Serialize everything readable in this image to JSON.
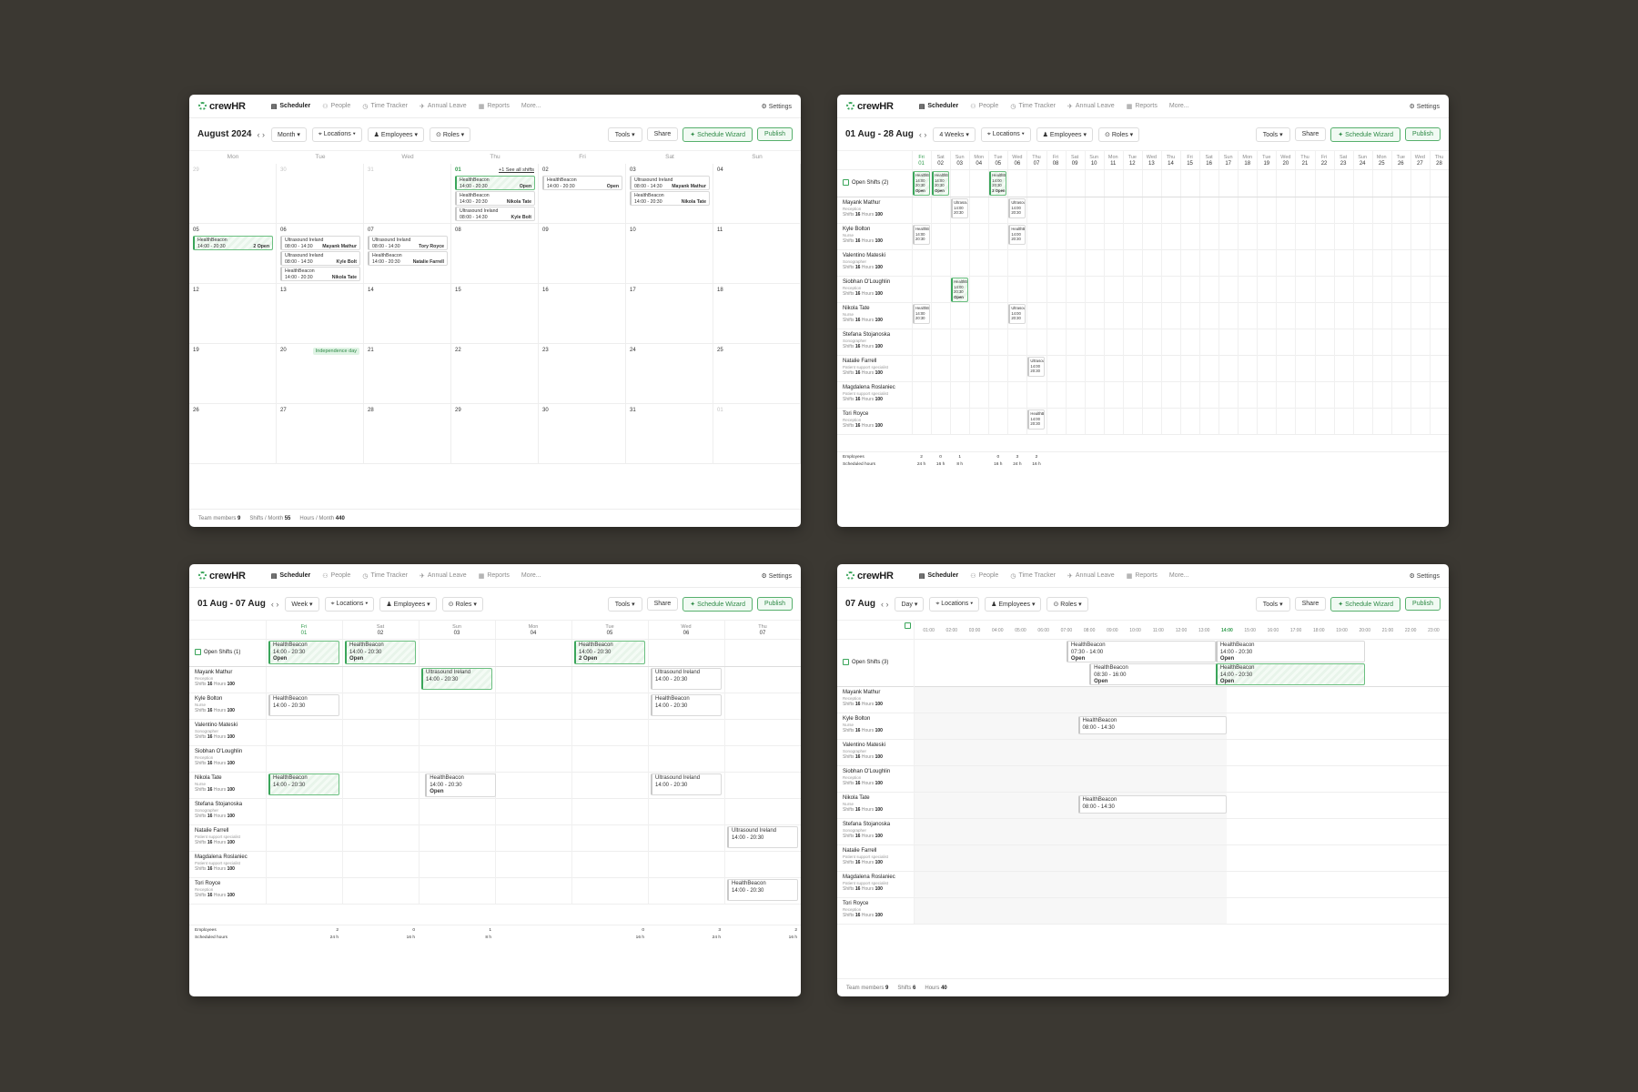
{
  "app": {
    "brand": "crewHR",
    "nav": [
      "Scheduler",
      "People",
      "Time Tracker",
      "Annual Leave",
      "Reports",
      "More..."
    ],
    "settings": "Settings",
    "filters": {
      "locations": "Locations",
      "employees": "Employees",
      "roles": "Roles"
    },
    "buttons": {
      "tools": "Tools",
      "share": "Share",
      "wizard": "Schedule Wizard",
      "publish": "Publish"
    }
  },
  "employees": [
    {
      "name": "Mayank Mathur",
      "role": "Reception"
    },
    {
      "name": "Kyle Bolton",
      "role": "Nurse"
    },
    {
      "name": "Valentino Mateski",
      "role": "Sonographer"
    },
    {
      "name": "Siobhan O'Loughlin",
      "role": "Reception"
    },
    {
      "name": "Nikola Tate",
      "role": "Nurse"
    },
    {
      "name": "Stefana Stojanoska",
      "role": "Sonographer"
    },
    {
      "name": "Natalie Farrell",
      "role": "Patient support specialist"
    },
    {
      "name": "Magdalena Roslaniec",
      "role": "Patient support specialist"
    },
    {
      "name": "Tori Royce",
      "role": "Reception"
    }
  ],
  "stats": {
    "shifts_label": "Shifts",
    "shifts": "16",
    "hours_label": "Hours",
    "hours": "100"
  },
  "month": {
    "title": "August 2024",
    "view": "Month",
    "weekdays": [
      "Mon",
      "Tue",
      "Wed",
      "Thu",
      "Fri",
      "Sat",
      "Sun"
    ],
    "days": [
      "29",
      "30",
      "31",
      "01",
      "02",
      "03",
      "04",
      "05",
      "06",
      "07",
      "08",
      "09",
      "10",
      "11",
      "12",
      "13",
      "14",
      "15",
      "16",
      "17",
      "18",
      "19",
      "20",
      "21",
      "22",
      "23",
      "24",
      "25",
      "26",
      "27",
      "28",
      "29",
      "30",
      "31",
      "01"
    ],
    "see_all": "+1 See all shifts",
    "holiday": "Independence day",
    "shifts": [
      {
        "cell": 3,
        "slot": 0,
        "l1": "HealthBeacon",
        "l2": "14:00 - 20:30",
        "tag": "Open",
        "open": true
      },
      {
        "cell": 3,
        "slot": 1,
        "l1": "HealthBeacon",
        "l2": "14:00 - 20:30",
        "tag": "Nikola Tate",
        "open": false
      },
      {
        "cell": 3,
        "slot": 2,
        "l1": "Ultrasound Ireland",
        "l2": "08:00 - 14:30",
        "tag": "Kyle Bolt",
        "open": false
      },
      {
        "cell": 4,
        "slot": 0,
        "l1": "HealthBeacon",
        "l2": "14:00 - 20:30",
        "tag": "Open",
        "open": false
      },
      {
        "cell": 5,
        "slot": 0,
        "l1": "Ultrasound Ireland",
        "l2": "08:00 - 14:30",
        "tag": "Mayank Mathur",
        "open": false
      },
      {
        "cell": 5,
        "slot": 1,
        "l1": "HealthBeacon",
        "l2": "14:00 - 20:30",
        "tag": "Nikola Tate",
        "open": false
      },
      {
        "cell": 7,
        "slot": 0,
        "l1": "HealthBeacon",
        "l2": "14:00 - 20:30",
        "tag": "2 Open",
        "open": true
      },
      {
        "cell": 8,
        "slot": 0,
        "l1": "Ultrasound Ireland",
        "l2": "08:00 - 14:30",
        "tag": "Mayank Mathur",
        "open": false
      },
      {
        "cell": 8,
        "slot": 1,
        "l1": "Ultrasound Ireland",
        "l2": "08:00 - 14:30",
        "tag": "Kyle Bolt",
        "open": false
      },
      {
        "cell": 8,
        "slot": 2,
        "l1": "HealthBeacon",
        "l2": "14:00 - 20:30",
        "tag": "Nikola Tate",
        "open": false
      },
      {
        "cell": 9,
        "slot": 0,
        "l1": "Ultrasound Ireland",
        "l2": "08:00 - 14:30",
        "tag": "Tory Royce",
        "open": false
      },
      {
        "cell": 9,
        "slot": 1,
        "l1": "HealthBeacon",
        "l2": "14:00 - 20:30",
        "tag": "Natalie Farrell",
        "open": false
      }
    ],
    "footer": {
      "team_label": "Team members",
      "team": "9",
      "shifts_label": "Shifts / Month",
      "shifts": "55",
      "hours_label": "Hours / Month",
      "hours": "440"
    }
  },
  "fourweek": {
    "title": "01 Aug - 28 Aug",
    "view": "4 Weeks",
    "days": [
      {
        "d": "Fri",
        "n": "01"
      },
      {
        "d": "Sat",
        "n": "02"
      },
      {
        "d": "Sun",
        "n": "03"
      },
      {
        "d": "Mon",
        "n": "04"
      },
      {
        "d": "Tue",
        "n": "05"
      },
      {
        "d": "Wed",
        "n": "06"
      },
      {
        "d": "Thu",
        "n": "07"
      },
      {
        "d": "Fri",
        "n": "08"
      },
      {
        "d": "Sat",
        "n": "09"
      },
      {
        "d": "Sun",
        "n": "10"
      },
      {
        "d": "Mon",
        "n": "11"
      },
      {
        "d": "Tue",
        "n": "12"
      },
      {
        "d": "Wed",
        "n": "13"
      },
      {
        "d": "Thu",
        "n": "14"
      },
      {
        "d": "Fri",
        "n": "15"
      },
      {
        "d": "Sat",
        "n": "16"
      },
      {
        "d": "Sun",
        "n": "17"
      },
      {
        "d": "Mon",
        "n": "18"
      },
      {
        "d": "Tue",
        "n": "19"
      },
      {
        "d": "Wed",
        "n": "20"
      },
      {
        "d": "Thu",
        "n": "21"
      },
      {
        "d": "Fri",
        "n": "22"
      },
      {
        "d": "Sat",
        "n": "23"
      },
      {
        "d": "Sun",
        "n": "24"
      },
      {
        "d": "Mon",
        "n": "25"
      },
      {
        "d": "Tue",
        "n": "26"
      },
      {
        "d": "Wed",
        "n": "27"
      },
      {
        "d": "Thu",
        "n": "28"
      }
    ],
    "open_label": "Open Shifts (2)",
    "open_shifts": [
      {
        "day": 0,
        "l1": "HealthB",
        "l2": "14:00",
        "l3": "20:30",
        "l4": "Open"
      },
      {
        "day": 1,
        "l1": "HealthB",
        "l2": "14:00",
        "l3": "20:30",
        "l4": "Open"
      },
      {
        "day": 4,
        "l1": "HealthB",
        "l2": "14:00",
        "l3": "20:30",
        "l4": "2 Open"
      }
    ],
    "shifts": [
      {
        "row": 0,
        "day": 2,
        "l1": "Ultrasou",
        "l2": "14:00",
        "l3": "20:30"
      },
      {
        "row": 0,
        "day": 5,
        "l1": "Ultrasou",
        "l2": "14:00",
        "l3": "20:30"
      },
      {
        "row": 1,
        "day": 0,
        "l1": "HealthB",
        "l2": "14:00",
        "l3": "20:30"
      },
      {
        "row": 1,
        "day": 5,
        "l1": "HealthB",
        "l2": "14:00",
        "l3": "20:30"
      },
      {
        "row": 3,
        "day": 2,
        "l1": "HealthB",
        "l2": "14:00",
        "l3": "20:30",
        "l4": "Open",
        "open": true
      },
      {
        "row": 4,
        "day": 0,
        "l1": "HealthB",
        "l2": "14:00",
        "l3": "20:30"
      },
      {
        "row": 4,
        "day": 5,
        "l1": "Ultrasou",
        "l2": "14:00",
        "l3": "20:30"
      },
      {
        "row": 6,
        "day": 6,
        "l1": "Ultrasou",
        "l2": "14:00",
        "l3": "20:30"
      },
      {
        "row": 8,
        "day": 6,
        "l1": "HealthB",
        "l2": "14:00",
        "l3": "20:30"
      }
    ],
    "summary_labels": [
      "Employees",
      "Scheduled hours"
    ],
    "summary": [
      {
        "day": 0,
        "e": "2",
        "h": "24 h"
      },
      {
        "day": 1,
        "e": "0",
        "h": "16 h"
      },
      {
        "day": 2,
        "e": "1",
        "h": "8 h"
      },
      {
        "day": 4,
        "e": "0",
        "h": "16 h"
      },
      {
        "day": 5,
        "e": "3",
        "h": "24 h"
      },
      {
        "day": 6,
        "e": "2",
        "h": "16 h"
      }
    ]
  },
  "week": {
    "title": "01 Aug - 07 Aug",
    "view": "Week",
    "days": [
      {
        "d": "Fri",
        "n": "01"
      },
      {
        "d": "Sat",
        "n": "02"
      },
      {
        "d": "Sun",
        "n": "03"
      },
      {
        "d": "Mon",
        "n": "04"
      },
      {
        "d": "Tue",
        "n": "05"
      },
      {
        "d": "Wed",
        "n": "06"
      },
      {
        "d": "Thu",
        "n": "07"
      }
    ],
    "open_label": "Open Shifts (1)",
    "open_shifts": [
      {
        "day": 0,
        "l1": "HealthBeacon",
        "l2": "14:00 - 20:30",
        "l3": "Open"
      },
      {
        "day": 1,
        "l1": "HealthBeacon",
        "l2": "14:00 - 20:30",
        "l3": "Open"
      },
      {
        "day": 4,
        "l1": "HealthBeacon",
        "l2": "14:00 - 20:30",
        "l3": "2 Open"
      }
    ],
    "shifts": [
      {
        "row": 0,
        "day": 2,
        "l1": "Ultrasound Ireland",
        "l2": "14:00 - 20:30",
        "open": true
      },
      {
        "row": 0,
        "day": 5,
        "l1": "Ultrasound Ireland",
        "l2": "14:00 - 20:30"
      },
      {
        "row": 1,
        "day": 0,
        "l1": "HealthBeacon",
        "l2": "14:00 - 20:30"
      },
      {
        "row": 1,
        "day": 5,
        "l1": "HealthBeacon",
        "l2": "14:00 - 20:30"
      },
      {
        "row": 4,
        "day": 0,
        "l1": "HealthBeacon",
        "l2": "14:00 - 20:30",
        "open": true
      },
      {
        "row": 4,
        "day": 2,
        "l1": "HealthBeacon",
        "l2": "14:00 - 20:30",
        "l3": "Open",
        "offset": 0.5
      },
      {
        "row": 4,
        "day": 5,
        "l1": "Ultrasound Ireland",
        "l2": "14:00 - 20:30"
      },
      {
        "row": 6,
        "day": 6,
        "l1": "Ultrasound Ireland",
        "l2": "14:00 - 20:30"
      },
      {
        "row": 8,
        "day": 6,
        "l1": "HealthBeacon",
        "l2": "14:00 - 20:30"
      }
    ],
    "summary_labels": [
      "Employees",
      "Scheduled hours"
    ],
    "summary": [
      {
        "day": 0,
        "e": "2",
        "h": "24 h"
      },
      {
        "day": 1,
        "e": "0",
        "h": "16 h"
      },
      {
        "day": 2,
        "e": "1",
        "h": "8 h"
      },
      {
        "day": 4,
        "e": "0",
        "h": "16 h"
      },
      {
        "day": 5,
        "e": "3",
        "h": "24 h"
      },
      {
        "day": 6,
        "e": "2",
        "h": "16 h"
      }
    ]
  },
  "day": {
    "title": "07 Aug",
    "view": "Day",
    "hours": [
      "01:00",
      "02:00",
      "03:00",
      "04:00",
      "05:00",
      "06:00",
      "07:00",
      "08:00",
      "09:00",
      "10:00",
      "11:00",
      "12:00",
      "13:00",
      "14:00",
      "15:00",
      "16:00",
      "17:00",
      "18:00",
      "19:00",
      "20:00",
      "21:00",
      "22:00",
      "23:00"
    ],
    "current_hour": "14:00",
    "open_label": "Open Shifts (3)",
    "open_shifts": [
      {
        "start": 7.5,
        "end": 14,
        "slot": 0,
        "l1": "HealthBeacon",
        "l2": "07:30 - 14:00",
        "l3": "Open"
      },
      {
        "start": 8.5,
        "end": 16,
        "slot": 1,
        "l1": "HealthBeacon",
        "l2": "08:30 - 16:00",
        "l3": "Open"
      },
      {
        "start": 14,
        "end": 20.5,
        "slot": 0,
        "l1": "HealthBeacon",
        "l2": "14:00 - 20:30",
        "l3": "Open"
      },
      {
        "start": 14,
        "end": 20.5,
        "slot": 1,
        "l1": "HealthBeacon",
        "l2": "14:00 - 20:30",
        "l3": "Open",
        "open": true
      }
    ],
    "shifts": [
      {
        "row": 1,
        "start": 8,
        "end": 14.5,
        "l1": "HealthBeacon",
        "l2": "08:00 - 14:30"
      },
      {
        "row": 4,
        "start": 8,
        "end": 14.5,
        "l1": "HealthBeacon",
        "l2": "08:00 - 14:30"
      }
    ],
    "footer": {
      "team_label": "Team members",
      "team": "9",
      "shifts_label": "Shifts",
      "shifts": "6",
      "hours_label": "Hours",
      "hours": "40"
    }
  }
}
